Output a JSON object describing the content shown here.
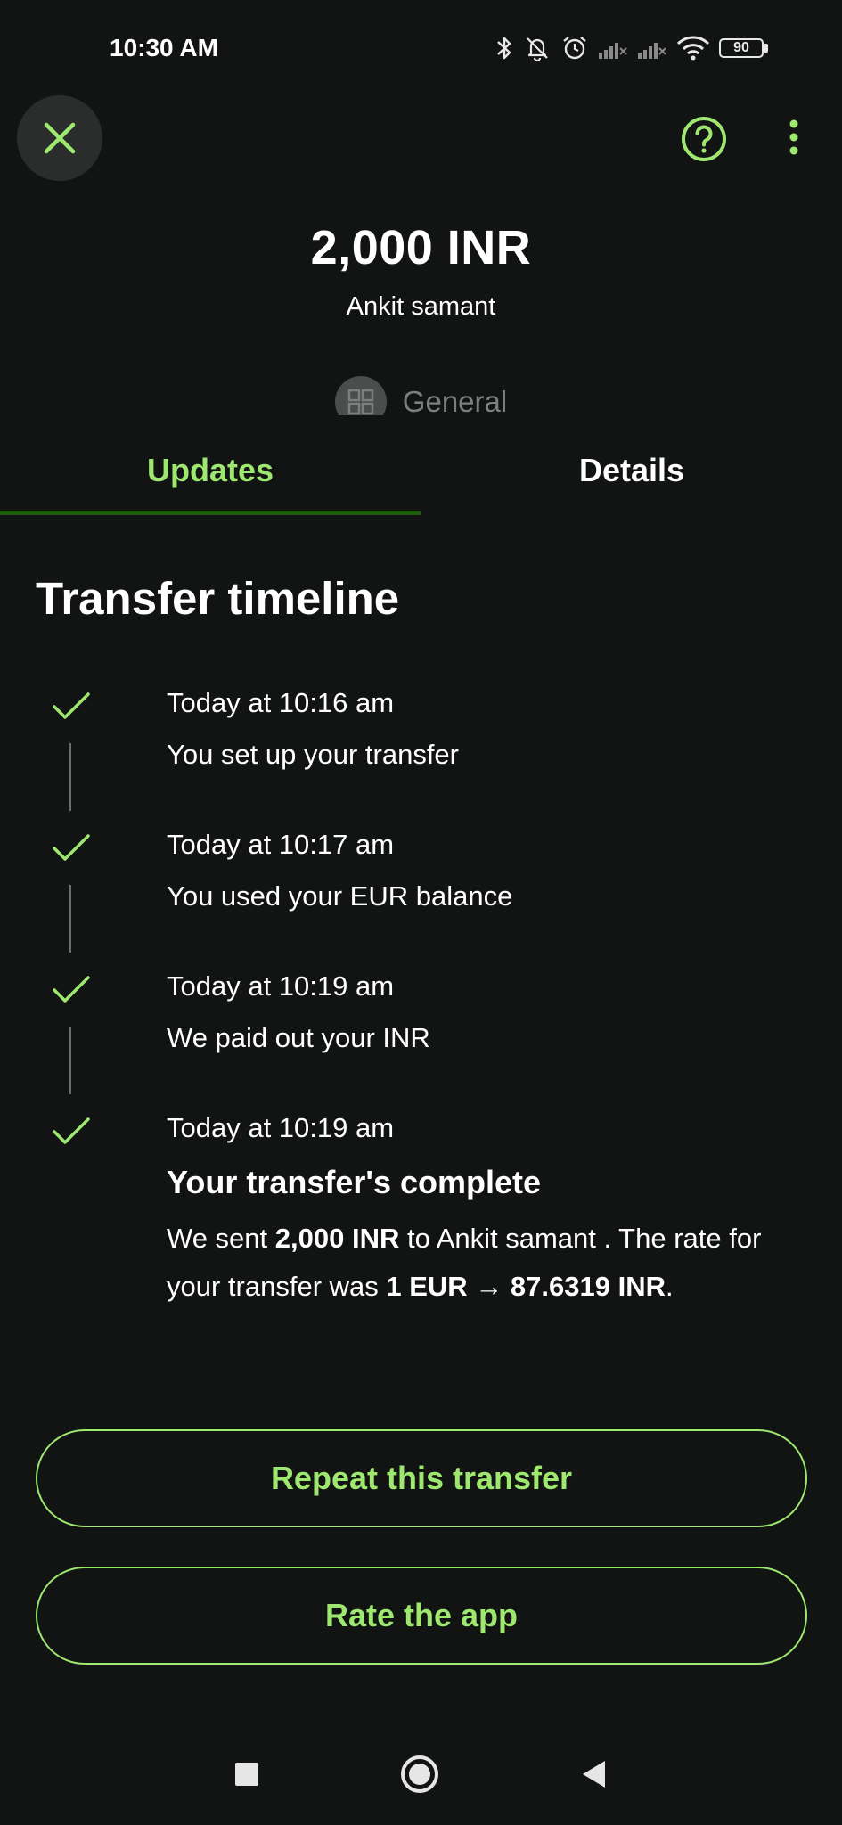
{
  "status_bar": {
    "time": "10:30 AM",
    "battery_level": "90",
    "icons": [
      "bluetooth-icon",
      "bell-off-icon",
      "alarm-icon",
      "signal-icon",
      "signal-icon",
      "wifi-icon",
      "battery-icon"
    ]
  },
  "header": {
    "close_icon": "close-icon",
    "help_icon": "help-circle-icon",
    "more_icon": "more-vertical-icon",
    "amount": "2,000 INR",
    "recipient": "Ankit samant",
    "category_icon": "grid-icon",
    "category": "General"
  },
  "tabs": [
    {
      "label": "Updates",
      "active": true
    },
    {
      "label": "Details",
      "active": false
    }
  ],
  "timeline": {
    "title": "Transfer timeline",
    "steps": [
      {
        "time": "Today at 10:16 am",
        "text": "You set up your transfer"
      },
      {
        "time": "Today at 10:17 am",
        "text": "You used your EUR balance"
      },
      {
        "time": "Today at 10:19 am",
        "text": "We paid out your INR"
      },
      {
        "time": "Today at 10:19 am",
        "headline": "Your transfer's complete",
        "body_parts": {
          "p1": "We sent ",
          "amount": "2,000 INR",
          "p2": " to Ankit samant . The rate for your transfer was ",
          "rate": "1 EUR → 87.6319 INR",
          "p3": "."
        }
      }
    ]
  },
  "actions": {
    "repeat": "Repeat this transfer",
    "rate": "Rate the app"
  },
  "colors": {
    "background": "#121413",
    "accent": "#9fe870",
    "tab_indicator": "#1e5b0d"
  }
}
